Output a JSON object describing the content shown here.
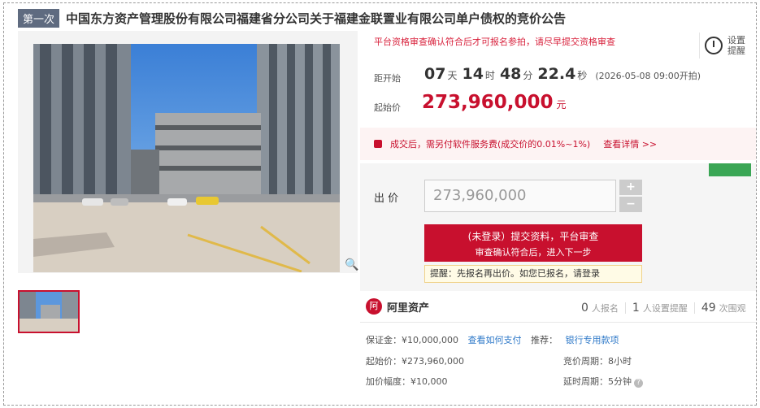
{
  "title": {
    "badge": "第一次",
    "text": "中国东方资产管理股份有限公司福建省分公司关于福建金联置业有限公司单户债权的竞价公告"
  },
  "notice": "平台资格审查确认符合后才可报名参拍，请尽早提交资格审查",
  "remind": {
    "line1": "设置",
    "line2": "提醒"
  },
  "countdown": {
    "label": "距开始",
    "days": "07",
    "days_unit": "天",
    "hours": "14",
    "hours_unit": "时",
    "minutes": "48",
    "minutes_unit": "分",
    "seconds": "22.4",
    "seconds_unit": "秒",
    "start": "(2026-05-08 09:00开拍)"
  },
  "start_price": {
    "label": "起始价",
    "value": "273,960,000",
    "unit": "元"
  },
  "fee": {
    "text": "成交后，需另付软件服务费(成交价的0.01%~1%)",
    "link": "查看详情 >>"
  },
  "bid": {
    "label": "出 价",
    "value": "273,960,000",
    "plus": "+",
    "minus": "−",
    "cta_line1": "(未登录）提交资料，平台审查",
    "cta_line2": "审查确认符合后，进入下一步",
    "hint": "提醒：先报名再出价。如您已报名，请登录"
  },
  "platform": {
    "logo": "阿",
    "name": "阿里资产"
  },
  "stats": {
    "signups": "0",
    "signups_label": "人报名",
    "reminders": "1",
    "reminders_label": "人设置提醒",
    "views": "49",
    "views_label": "次围观"
  },
  "info": {
    "deposit": "保证金：¥10,000,000",
    "deposit_link": "查看如何支付",
    "recommend": "推荐：",
    "recommend_link": "银行专用款项",
    "start": "起始价：¥273,960,000",
    "cycle": "竞价周期：8小时",
    "increment": "加价幅度：¥10,000",
    "delay": "延时周期：5分钟",
    "help": "?"
  },
  "colors": {
    "accent": "#c8102e",
    "badge": "#5f6b80",
    "link": "#2d78c8"
  },
  "icons": [
    "zoom-icon",
    "alarm-clock-icon",
    "lock-icon",
    "alibaba-logo-icon",
    "help-icon"
  ]
}
